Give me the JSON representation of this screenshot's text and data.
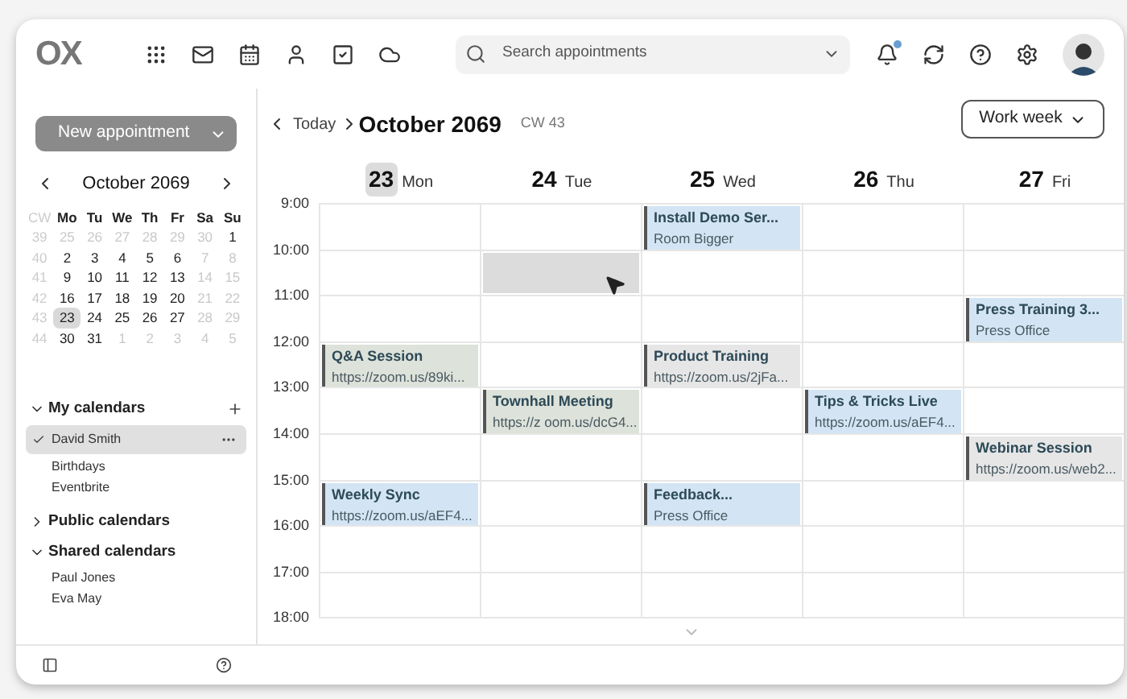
{
  "header": {
    "logo": "OX",
    "search": {
      "placeholder": "Search appointments"
    },
    "has_unread_notifications": true
  },
  "sidebar": {
    "new_button": "New appointment",
    "mini_calendar": {
      "title": "October 2069",
      "headers": [
        "CW",
        "Mo",
        "Tu",
        "We",
        "Th",
        "Fr",
        "Sa",
        "Su"
      ],
      "weeks": [
        {
          "cw": "39",
          "days": [
            {
              "label": "25",
              "muted": true,
              "selected": false
            },
            {
              "label": "26",
              "muted": true,
              "selected": false
            },
            {
              "label": "27",
              "muted": true,
              "selected": false
            },
            {
              "label": "28",
              "muted": true,
              "selected": false
            },
            {
              "label": "29",
              "muted": true,
              "selected": false
            },
            {
              "label": "30",
              "muted": true,
              "selected": false
            },
            {
              "label": "1",
              "muted": false,
              "selected": false
            }
          ]
        },
        {
          "cw": "40",
          "days": [
            {
              "label": "2",
              "muted": false,
              "selected": false
            },
            {
              "label": "3",
              "muted": false,
              "selected": false
            },
            {
              "label": "4",
              "muted": false,
              "selected": false
            },
            {
              "label": "5",
              "muted": false,
              "selected": false
            },
            {
              "label": "6",
              "muted": false,
              "selected": false
            },
            {
              "label": "7",
              "muted": true,
              "selected": false
            },
            {
              "label": "8",
              "muted": true,
              "selected": false
            }
          ]
        },
        {
          "cw": "41",
          "days": [
            {
              "label": "9",
              "muted": false,
              "selected": false
            },
            {
              "label": "10",
              "muted": false,
              "selected": false
            },
            {
              "label": "11",
              "muted": false,
              "selected": false
            },
            {
              "label": "12",
              "muted": false,
              "selected": false
            },
            {
              "label": "13",
              "muted": false,
              "selected": false
            },
            {
              "label": "14",
              "muted": true,
              "selected": false
            },
            {
              "label": "15",
              "muted": true,
              "selected": false
            }
          ]
        },
        {
          "cw": "42",
          "days": [
            {
              "label": "16",
              "muted": false,
              "selected": false
            },
            {
              "label": "17",
              "muted": false,
              "selected": false
            },
            {
              "label": "18",
              "muted": false,
              "selected": false
            },
            {
              "label": "19",
              "muted": false,
              "selected": false
            },
            {
              "label": "20",
              "muted": false,
              "selected": false
            },
            {
              "label": "21",
              "muted": true,
              "selected": false
            },
            {
              "label": "22",
              "muted": true,
              "selected": false
            }
          ]
        },
        {
          "cw": "43",
          "days": [
            {
              "label": "23",
              "muted": false,
              "selected": true
            },
            {
              "label": "24",
              "muted": false,
              "selected": false
            },
            {
              "label": "25",
              "muted": false,
              "selected": false
            },
            {
              "label": "26",
              "muted": false,
              "selected": false
            },
            {
              "label": "27",
              "muted": false,
              "selected": false
            },
            {
              "label": "28",
              "muted": true,
              "selected": false
            },
            {
              "label": "29",
              "muted": true,
              "selected": false
            }
          ]
        },
        {
          "cw": "44",
          "days": [
            {
              "label": "30",
              "muted": false,
              "selected": false
            },
            {
              "label": "31",
              "muted": false,
              "selected": false
            },
            {
              "label": "1",
              "muted": true,
              "selected": false
            },
            {
              "label": "2",
              "muted": true,
              "selected": false
            },
            {
              "label": "3",
              "muted": true,
              "selected": false
            },
            {
              "label": "4",
              "muted": true,
              "selected": false
            },
            {
              "label": "5",
              "muted": true,
              "selected": false
            }
          ]
        }
      ]
    },
    "sections": [
      {
        "label": "My calendars",
        "expanded": true,
        "can_add": true,
        "items": [
          {
            "label": "David Smith",
            "selected": true,
            "checked": true
          },
          {
            "label": "Birthdays",
            "selected": false,
            "checked": false
          },
          {
            "label": "Eventbrite",
            "selected": false,
            "checked": false
          }
        ]
      },
      {
        "label": "Public calendars",
        "expanded": false,
        "can_add": false
      },
      {
        "label": "Shared calendars",
        "expanded": true,
        "can_add": false,
        "items": [
          {
            "label": "Paul Jones",
            "selected": false,
            "checked": false
          },
          {
            "label": "Eva May",
            "selected": false,
            "checked": false
          }
        ]
      }
    ]
  },
  "toolbar": {
    "today": "Today",
    "title": "October 2069",
    "week": "CW 43",
    "view": "Work week"
  },
  "days": [
    {
      "number": "23",
      "name": "Mon",
      "selected": true
    },
    {
      "number": "24",
      "name": "Tue",
      "selected": false
    },
    {
      "number": "25",
      "name": "Wed",
      "selected": false
    },
    {
      "number": "26",
      "name": "Thu",
      "selected": false
    },
    {
      "number": "27",
      "name": "Fri",
      "selected": false
    }
  ],
  "hours": [
    "9:00",
    "10:00",
    "11:00",
    "12:00",
    "13:00",
    "14:00",
    "15:00",
    "16:00",
    "17:00",
    "18:00"
  ],
  "rows": [
    {
      "cells": [
        {
          "kind": "empty"
        },
        {
          "kind": "empty"
        },
        {
          "kind": "event",
          "title": "Install Demo Ser...",
          "detail": "Room Bigger",
          "color": "#d3e5f4"
        },
        {
          "kind": "empty"
        },
        {
          "kind": "empty"
        }
      ]
    },
    {
      "cells": [
        {
          "kind": "empty"
        },
        {
          "kind": "selection"
        },
        {
          "kind": "empty"
        },
        {
          "kind": "empty"
        },
        {
          "kind": "empty"
        }
      ]
    },
    {
      "cells": [
        {
          "kind": "empty"
        },
        {
          "kind": "empty"
        },
        {
          "kind": "empty"
        },
        {
          "kind": "empty"
        },
        {
          "kind": "event",
          "title": "Press Training 3...",
          "detail": "Press Office",
          "color": "#d3e5f4"
        }
      ]
    },
    {
      "cells": [
        {
          "kind": "event",
          "title": "Q&A Session",
          "detail": "https://zoom.us/89ki...",
          "color": "#dde2da"
        },
        {
          "kind": "empty"
        },
        {
          "kind": "event",
          "title": "Product Training",
          "detail": "https://zoom.us/2jFa...",
          "color": "#e6e6e6"
        },
        {
          "kind": "empty"
        },
        {
          "kind": "empty"
        }
      ]
    },
    {
      "cells": [
        {
          "kind": "empty"
        },
        {
          "kind": "event",
          "title": "Townhall Meeting",
          "detail": "https://z oom.us/dcG4...",
          "color": "#dde2da"
        },
        {
          "kind": "empty"
        },
        {
          "kind": "event",
          "title": "Tips & Tricks Live",
          "detail": "https://zoom.us/aEF4...",
          "color": "#d3e5f4"
        },
        {
          "kind": "empty"
        }
      ]
    },
    {
      "cells": [
        {
          "kind": "empty"
        },
        {
          "kind": "empty"
        },
        {
          "kind": "empty"
        },
        {
          "kind": "empty"
        },
        {
          "kind": "event",
          "title": "Webinar Session",
          "detail": "https://zoom.us/web2...",
          "color": "#e6e6e6"
        }
      ]
    },
    {
      "cells": [
        {
          "kind": "event",
          "title": "Weekly Sync",
          "detail": "https://zoom.us/aEF4...",
          "color": "#d3e5f4"
        },
        {
          "kind": "empty"
        },
        {
          "kind": "event",
          "title": "Feedback...",
          "detail": "Press Office",
          "color": "#d3e5f4"
        },
        {
          "kind": "empty"
        },
        {
          "kind": "empty"
        }
      ]
    },
    {
      "cells": [
        {
          "kind": "empty"
        },
        {
          "kind": "empty"
        },
        {
          "kind": "empty"
        },
        {
          "kind": "empty"
        },
        {
          "kind": "empty"
        }
      ]
    },
    {
      "cells": [
        {
          "kind": "empty"
        },
        {
          "kind": "empty"
        },
        {
          "kind": "empty"
        },
        {
          "kind": "empty"
        },
        {
          "kind": "empty"
        }
      ]
    }
  ]
}
